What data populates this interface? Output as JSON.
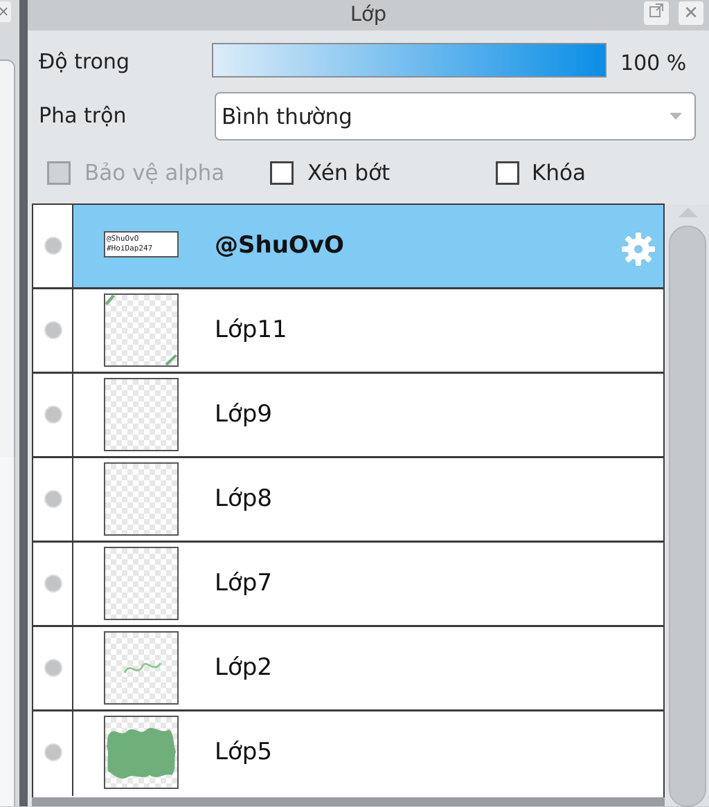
{
  "panel": {
    "title": "Lớp"
  },
  "opacity": {
    "label": "Độ trong",
    "value": "100 %",
    "fraction": 1.0
  },
  "blend": {
    "label": "Pha trộn",
    "selected": "Bình thường"
  },
  "checkboxes": [
    {
      "label": "Bảo vệ alpha",
      "checked": false,
      "disabled": true
    },
    {
      "label": "Xén bớt",
      "checked": false,
      "disabled": false
    },
    {
      "label": "Khóa",
      "checked": false,
      "disabled": false
    }
  ],
  "layers": [
    {
      "name": "@ShuOvO",
      "selected": true,
      "thumb_text": "@ShuOvO #HoiDap247"
    },
    {
      "name": "Lớp11",
      "selected": false
    },
    {
      "name": "Lớp9",
      "selected": false
    },
    {
      "name": "Lớp8",
      "selected": false
    },
    {
      "name": "Lớp7",
      "selected": false
    },
    {
      "name": "Lớp2",
      "selected": false
    },
    {
      "name": "Lớp5",
      "selected": false
    }
  ],
  "colors": {
    "selected_row": "#7fcbf4",
    "opacity_gradient_end": "#0a8ee6",
    "thumb_green": "#6fb07a"
  },
  "icons": [
    "close-icon",
    "float-window-icon",
    "gear-icon",
    "visibility-dot-icon",
    "dropdown-arrow-icon",
    "scroll-up-icon"
  ]
}
